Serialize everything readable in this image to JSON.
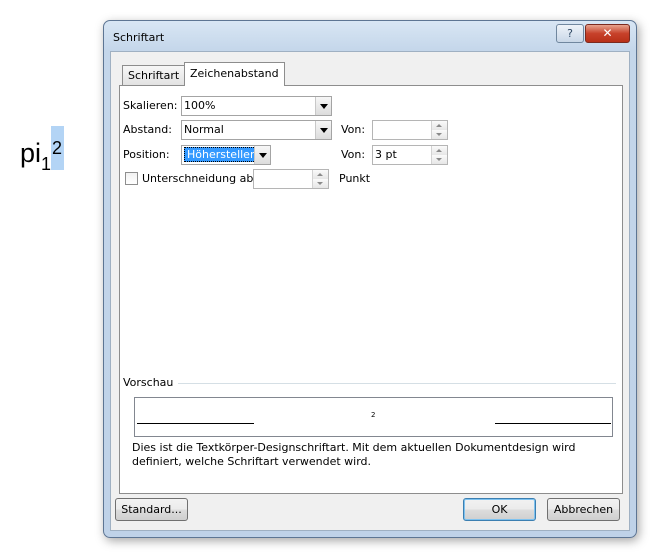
{
  "document": {
    "base": "pi",
    "subscript": "1",
    "superscript": "2"
  },
  "window": {
    "title": "Schriftart",
    "help_label": "?",
    "close_label": "✕"
  },
  "tabs": [
    {
      "label": "Schriftart",
      "active": false
    },
    {
      "label": "Zeichenabstand",
      "active": true
    }
  ],
  "fields": {
    "scale": {
      "label": "Skalieren:",
      "value": "100%"
    },
    "spacing": {
      "label": "Abstand:",
      "value": "Normal",
      "by_label": "Von:",
      "by_value": ""
    },
    "position": {
      "label": "Position:",
      "value": "Höherstellen",
      "by_label": "Von:",
      "by_value": "3 pt"
    },
    "kerning": {
      "label": "Unterschneidung ab:",
      "value": "",
      "unit": "Punkt",
      "checked": false
    }
  },
  "preview": {
    "label": "Vorschau",
    "sample": "2",
    "description": "Dies ist die Textkörper-Designschriftart. Mit dem aktuellen Dokumentdesign wird definiert, welche Schriftart verwendet wird."
  },
  "buttons": {
    "default_label": "Standard...",
    "ok_label": "OK",
    "cancel_label": "Abbrechen"
  },
  "colors": {
    "selection": "#3399ff",
    "title_gradient": "#c4d6ea",
    "close_button": "#c7412a"
  }
}
